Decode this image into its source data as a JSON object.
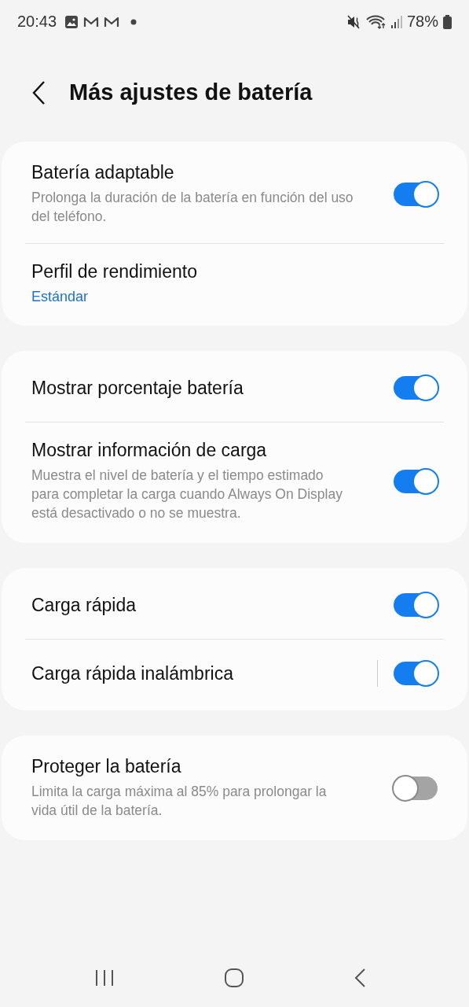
{
  "status_bar": {
    "time": "20:43",
    "battery": "78%"
  },
  "header": {
    "title": "Más ajustes de batería"
  },
  "groups": [
    {
      "items": [
        {
          "kind": "toggle",
          "title": "Batería adaptable",
          "subtitle": "Prolonga la duración de la batería en función del uso del teléfono.",
          "on": true,
          "split": false
        },
        {
          "kind": "value",
          "title": "Perfil de rendimiento",
          "value": "Estándar"
        }
      ]
    },
    {
      "items": [
        {
          "kind": "toggle",
          "title": "Mostrar porcentaje batería",
          "on": true,
          "split": false
        },
        {
          "kind": "toggle",
          "title": "Mostrar información de carga",
          "subtitle": "Muestra el nivel de batería y el tiempo estimado para completar la carga cuando Always On Display está desactivado o no se muestra.",
          "on": true,
          "split": false
        }
      ]
    },
    {
      "items": [
        {
          "kind": "toggle",
          "title": "Carga rápida",
          "on": true,
          "split": false
        },
        {
          "kind": "toggle",
          "title": "Carga rápida inalámbrica",
          "on": true,
          "split": true
        }
      ]
    },
    {
      "items": [
        {
          "kind": "toggle",
          "title": "Proteger la batería",
          "subtitle": "Limita la carga máxima al 85% para prolongar la vida útil de la batería.",
          "on": false,
          "split": false
        }
      ]
    }
  ]
}
